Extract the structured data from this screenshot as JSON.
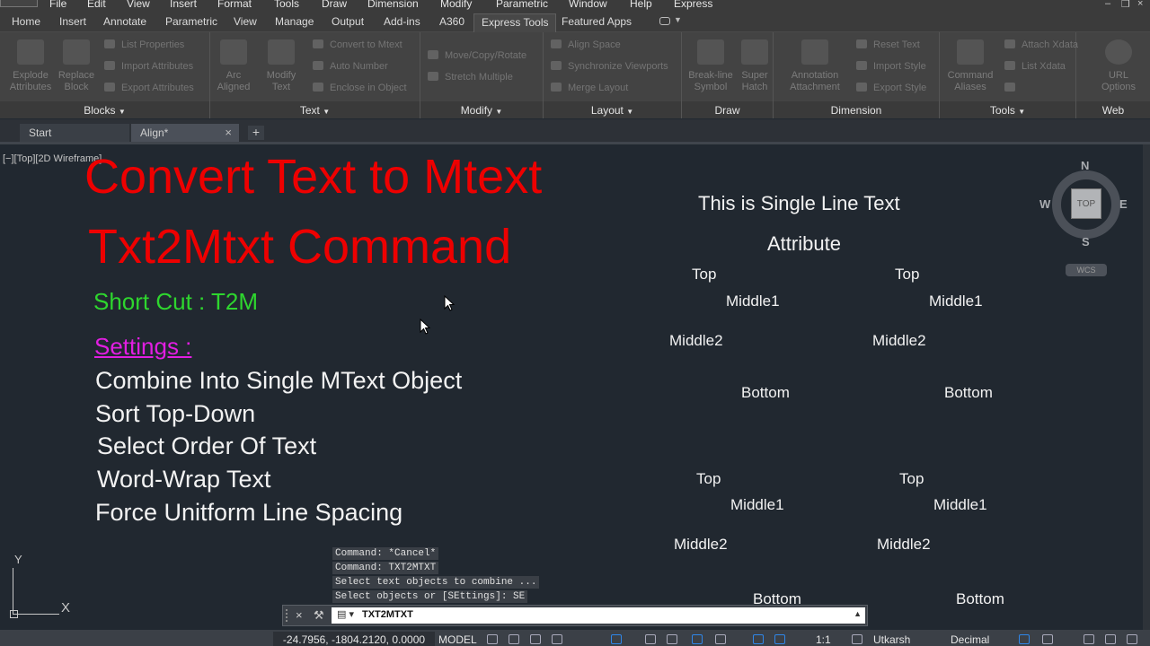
{
  "menu": [
    "File",
    "Edit",
    "View",
    "Insert",
    "Format",
    "Tools",
    "Draw",
    "Dimension",
    "Modify",
    "Parametric",
    "Window",
    "Help",
    "Express"
  ],
  "ribbon_tabs": [
    "Home",
    "Insert",
    "Annotate",
    "Parametric",
    "View",
    "Manage",
    "Output",
    "Add-ins",
    "A360",
    "Express Tools",
    "Featured Apps"
  ],
  "active_tab": "Express Tools",
  "panels": {
    "blocks": {
      "title": "Blocks",
      "big": [
        {
          "l1": "Explode",
          "l2": "Attributes"
        },
        {
          "l1": "Replace",
          "l2": "Block"
        }
      ],
      "small": [
        "List Properties",
        "Import Attributes",
        "Export Attributes"
      ]
    },
    "text": {
      "title": "Text",
      "big": [
        {
          "l1": "Arc",
          "l2": "Aligned"
        },
        {
          "l1": "Modify",
          "l2": "Text"
        }
      ],
      "small": [
        "Convert to Mtext",
        "Auto Number",
        "Enclose in Object"
      ]
    },
    "modify": {
      "title": "Modify",
      "small": [
        "Move/Copy/Rotate",
        "Stretch Multiple"
      ]
    },
    "layout": {
      "title": "Layout",
      "small": [
        "Align Space",
        "Synchronize Viewports",
        "Merge Layout"
      ]
    },
    "draw": {
      "title": "Draw",
      "big": [
        {
          "l1": "Break-line",
          "l2": "Symbol"
        },
        {
          "l1": "Super",
          "l2": "Hatch"
        }
      ]
    },
    "dimension": {
      "title": "Dimension",
      "big": [
        {
          "l1": "Annotation",
          "l2": "Attachment"
        }
      ],
      "small": [
        "Reset Text",
        "Import Style",
        "Export Style"
      ]
    },
    "tools": {
      "title": "Tools",
      "big": [
        {
          "l1": "Command",
          "l2": "Aliases"
        }
      ],
      "small": [
        "Attach Xdata",
        "List Xdata"
      ]
    },
    "web": {
      "title": "Web",
      "big": [
        {
          "l1": "URL",
          "l2": "Options"
        }
      ]
    }
  },
  "file_tabs": {
    "start": "Start",
    "current": "Align*",
    "close": "×",
    "add": "+"
  },
  "viewport_label": "[−][Top][2D Wireframe]",
  "drawing_text": {
    "title1": "Convert Text to Mtext",
    "title2": "Txt2Mtxt Command",
    "shortcut": "Short Cut : T2M",
    "settings": "Settings :",
    "options": [
      "Combine Into Single MText Object",
      "Sort Top-Down",
      "Select Order Of Text",
      "Word-Wrap Text",
      "Force Unitform Line Spacing"
    ],
    "single_line": "This is Single Line Text",
    "attribute": "Attribute",
    "top": "Top",
    "middle1": "Middle1",
    "middle2": "Middle2",
    "bottom": "Bottom"
  },
  "viewcube": {
    "n": "N",
    "s": "S",
    "e": "E",
    "w": "W",
    "face": "TOP",
    "wcs": "WCS"
  },
  "ucs": {
    "x": "X",
    "y": "Y"
  },
  "command_history": [
    "Command: *Cancel*",
    "Command: TXT2MTXT",
    "Select text objects to combine ...",
    "Select objects or [SEttings]: SE"
  ],
  "command_line": {
    "prompt_icon": "▤ ▾",
    "value": "TXT2MTXT"
  },
  "status": {
    "coords": "-24.7956, -1804.2120, 0.0000",
    "model": "MODEL",
    "scale": "1:1",
    "user": "Utkarsh",
    "units": "Decimal"
  }
}
